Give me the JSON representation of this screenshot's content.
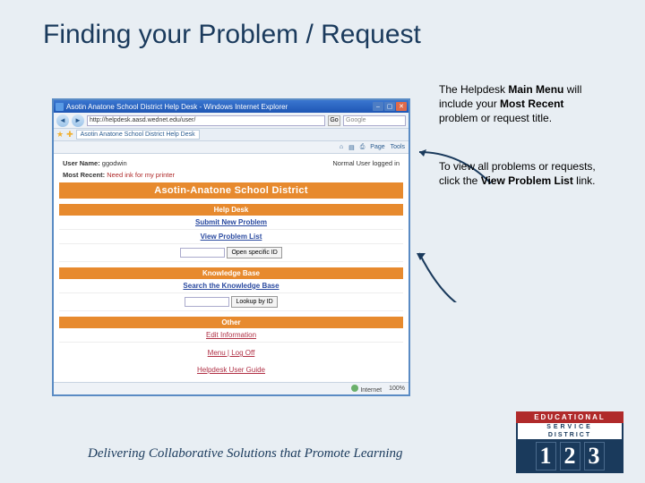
{
  "slide": {
    "title": "Finding your Problem / Request",
    "footer": "Delivering Collaborative Solutions that Promote Learning"
  },
  "captions": {
    "c1_part1": "The Helpdesk ",
    "c1_bold1": "Main Menu",
    "c1_part2": " will include your ",
    "c1_bold2": "Most Recent",
    "c1_part3": " problem or request title.",
    "c2_part1": "To view all problems or requests, click the ",
    "c2_bold1": "View Problem List",
    "c2_part2": " link."
  },
  "ie": {
    "title": "Asotin Anatone School District Help Desk - Windows Internet Explorer",
    "url": "http://helpdesk.aasd.wednet.edu/user/",
    "go": "Go",
    "search_placeholder": "Google",
    "tab": "Asotin Anatone School District Help Desk",
    "tool_page": "Page",
    "tool_tools": "Tools",
    "status_internet": "Internet",
    "status_zoom": "100%"
  },
  "page": {
    "username_label": "User Name:",
    "username_value": "ggodwin",
    "user_status": "Normal User logged in",
    "mostrecent_label": "Most Recent:",
    "mostrecent_value": "Need ink for my printer",
    "district_banner": "Asotin-Anatone School District",
    "hd_header": "Help Desk",
    "submit": "Submit New Problem",
    "view_list": "View Problem List",
    "open_specific": "Open specific ID",
    "kb_header": "Knowledge Base",
    "search_kb": "Search the Knowledge Base",
    "lookup": "Lookup by ID",
    "other_header": "Other",
    "edit_info": "Edit Information",
    "menu_logoff": "Menu | Log Off",
    "guide": "Helpdesk User Guide"
  },
  "logo": {
    "line1": "EDUCATIONAL",
    "line2": "SERVICE",
    "line3": "DISTRICT",
    "d1": "1",
    "d2": "2",
    "d3": "3"
  }
}
